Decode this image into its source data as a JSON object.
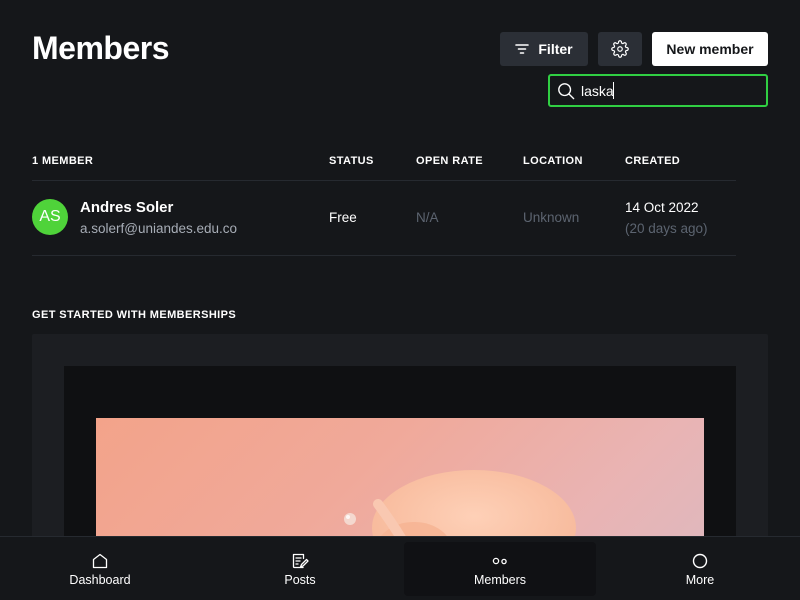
{
  "header": {
    "title": "Members",
    "filter_label": "Filter",
    "new_member_label": "New member"
  },
  "search": {
    "value": "laska",
    "placeholder": ""
  },
  "table": {
    "columns": [
      "1 MEMBER",
      "STATUS",
      "OPEN RATE",
      "LOCATION",
      "CREATED"
    ],
    "rows": [
      {
        "initials": "AS",
        "name": "Andres Soler",
        "email": "a.solerf@uniandes.edu.co",
        "status": "Free",
        "open_rate": "N/A",
        "location": "Unknown",
        "created": "14 Oct 2022",
        "created_relative": "(20 days ago)"
      }
    ]
  },
  "memberships": {
    "title": "GET STARTED WITH MEMBERSHIPS"
  },
  "nav": {
    "items": [
      {
        "label": "Dashboard",
        "icon": "home-icon",
        "active": false
      },
      {
        "label": "Posts",
        "icon": "posts-icon",
        "active": false
      },
      {
        "label": "Members",
        "icon": "members-icon",
        "active": true
      },
      {
        "label": "More",
        "icon": "circle-icon",
        "active": false
      }
    ]
  },
  "colors": {
    "background": "#15171a",
    "search_focus": "#30cf43",
    "avatar": "#4fd33a",
    "muted_text": "#5c6470"
  }
}
